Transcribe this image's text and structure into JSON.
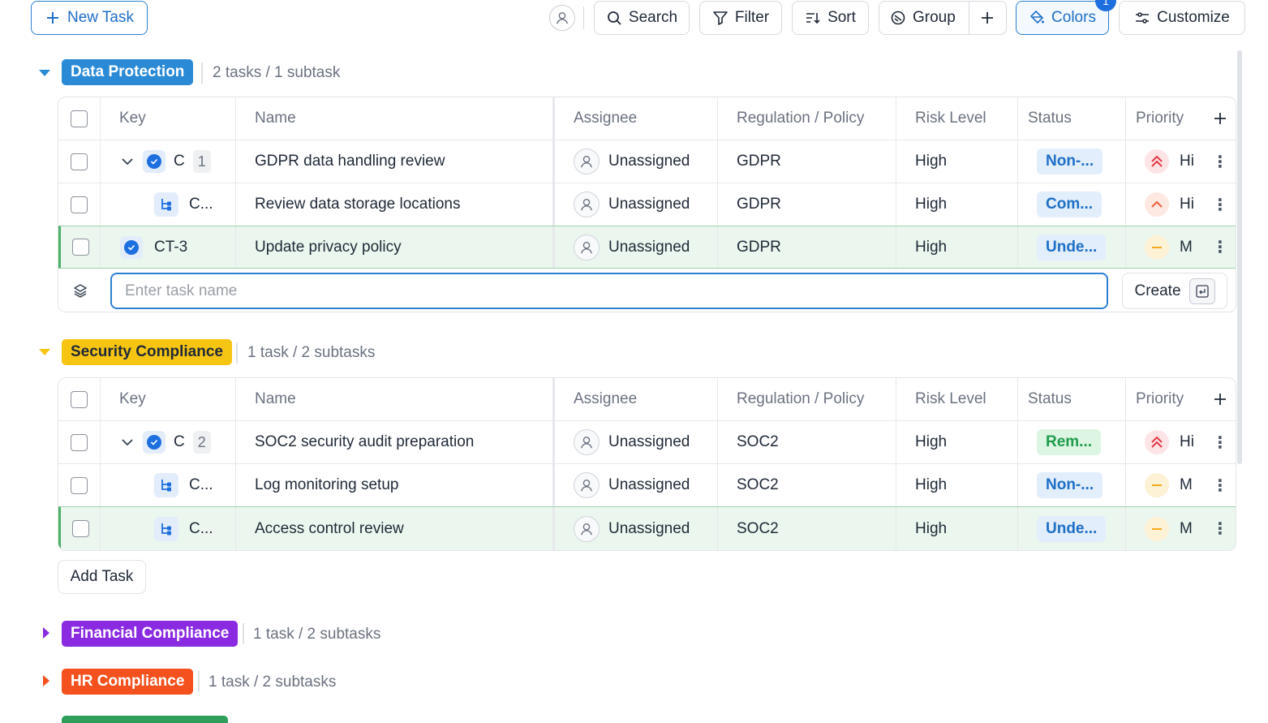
{
  "toolbar": {
    "new_task": "New Task",
    "search": "Search",
    "filter": "Filter",
    "sort": "Sort",
    "group": "Group",
    "colors": "Colors",
    "customize": "Customize",
    "colors_badge": "1"
  },
  "columns": {
    "key": "Key",
    "name": "Name",
    "assignee": "Assignee",
    "regulation": "Regulation / Policy",
    "risk": "Risk Level",
    "status": "Status",
    "priority": "Priority"
  },
  "groups": [
    {
      "label": "Data Protection",
      "count": "2 tasks / 1 subtask",
      "color": "#2a8ad6",
      "expanded": true,
      "rows": [
        {
          "key": "C",
          "num": "1",
          "name": "GDPR data handling review",
          "assignee": "Unassigned",
          "regulation": "GDPR",
          "risk": "High",
          "status": "Non-...",
          "priority": "Hi",
          "prio_level": "highest"
        },
        {
          "key": "C...",
          "name": "Review data storage locations",
          "assignee": "Unassigned",
          "regulation": "GDPR",
          "risk": "High",
          "status": "Com...",
          "priority": "Hi",
          "prio_level": "high"
        },
        {
          "key": "CT-3",
          "name": "Update privacy policy",
          "assignee": "Unassigned",
          "regulation": "GDPR",
          "risk": "High",
          "status": "Unde...",
          "priority": "M",
          "prio_level": "medium"
        }
      ],
      "input_placeholder": "Enter task name",
      "create_label": "Create"
    },
    {
      "label": "Security Compliance",
      "count": "1 task / 2 subtasks",
      "color": "#f6c513",
      "expanded": true,
      "rows": [
        {
          "key": "C",
          "num": "2",
          "name": "SOC2 security audit preparation",
          "assignee": "Unassigned",
          "regulation": "SOC2",
          "risk": "High",
          "status": "Rem...",
          "priority": "Hi",
          "prio_level": "highest"
        },
        {
          "key": "C...",
          "name": "Log monitoring setup",
          "assignee": "Unassigned",
          "regulation": "SOC2",
          "risk": "High",
          "status": "Non-...",
          "priority": "M",
          "prio_level": "medium"
        },
        {
          "key": "C...",
          "name": "Access control review",
          "assignee": "Unassigned",
          "regulation": "SOC2",
          "risk": "High",
          "status": "Unde...",
          "priority": "M",
          "prio_level": "medium"
        }
      ],
      "add_task": "Add Task"
    },
    {
      "label": "Financial Compliance",
      "count": "1 task / 2 subtasks",
      "color": "#8a2be2",
      "expanded": false
    },
    {
      "label": "HR Compliance",
      "count": "1 task / 2 subtasks",
      "color": "#f4511e",
      "expanded": false
    }
  ]
}
